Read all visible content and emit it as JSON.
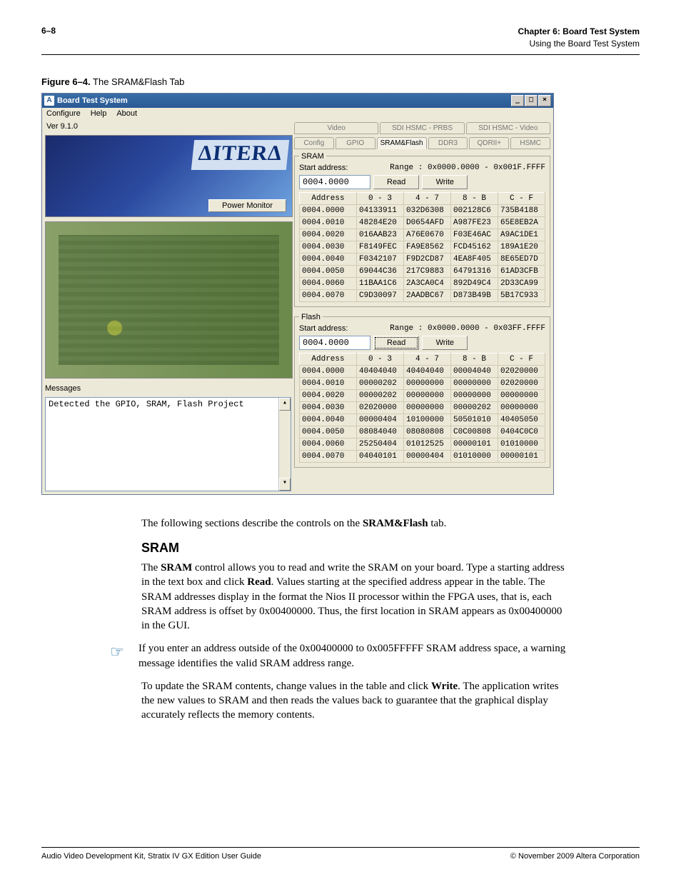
{
  "page": {
    "number": "6–8",
    "chapter": "Chapter 6:  Board Test System",
    "section": "Using the Board Test System"
  },
  "figcap": {
    "label": "Figure 6–4.",
    "title": "The SRAM&Flash Tab"
  },
  "win": {
    "title": "Board Test System",
    "menu": [
      "Configure",
      "Help",
      "About"
    ],
    "version": "Ver 9.1.0",
    "altera_logo": "ΔITERΔ",
    "power_monitor": "Power Monitor",
    "messages_label": "Messages",
    "messages_text": "Detected the GPIO, SRAM, Flash Project",
    "tabs_top": [
      "Video",
      "SDI HSMC - PRBS",
      "SDI HSMC - Video"
    ],
    "tabs_bot": [
      "Config",
      "GPIO",
      "SRAM&Flash",
      "DDR3",
      "QDRII+",
      "HSMC"
    ],
    "active_tab": "SRAM&Flash",
    "labels": {
      "start_addr": "Start address:",
      "read": "Read",
      "write": "Write",
      "headers": [
        "Address",
        "0 - 3",
        "4 - 7",
        "8 - B",
        "C - F"
      ]
    },
    "sram": {
      "legend": "SRAM",
      "range": "Range : 0x0000.0000 - 0x001F.FFFF",
      "addr": "0004.0000",
      "rows": [
        [
          "0004.0000",
          "04133911",
          "032D6308",
          "002128C6",
          "735B4188"
        ],
        [
          "0004.0010",
          "48284E20",
          "D0654AFD",
          "A987FE23",
          "65E8EB2A"
        ],
        [
          "0004.0020",
          "016AAB23",
          "A76E0670",
          "F03E46AC",
          "A9AC1DE1"
        ],
        [
          "0004.0030",
          "F8149FEC",
          "FA9E8562",
          "FCD45162",
          "189A1E20"
        ],
        [
          "0004.0040",
          "F0342107",
          "F9D2CD87",
          "4EA8F405",
          "8E65ED7D"
        ],
        [
          "0004.0050",
          "69044C36",
          "217C9883",
          "64791316",
          "61AD3CFB"
        ],
        [
          "0004.0060",
          "11BAA1C6",
          "2A3CA0C4",
          "892D49C4",
          "2D33CA99"
        ],
        [
          "0004.0070",
          "C9D30097",
          "2AADBC67",
          "D873B49B",
          "5B17C933"
        ]
      ]
    },
    "flash": {
      "legend": "Flash",
      "range": "Range : 0x0000.0000 - 0x03FF.FFFF",
      "addr": "0004.0000",
      "rows": [
        [
          "0004.0000",
          "40404040",
          "40404040",
          "00004040",
          "02020000"
        ],
        [
          "0004.0010",
          "00000202",
          "00000000",
          "00000000",
          "02020000"
        ],
        [
          "0004.0020",
          "00000202",
          "00000000",
          "00000000",
          "00000000"
        ],
        [
          "0004.0030",
          "02020000",
          "00000000",
          "00000202",
          "00000000"
        ],
        [
          "0004.0040",
          "00000404",
          "10100000",
          "50501010",
          "40405050"
        ],
        [
          "0004.0050",
          "08084040",
          "08080808",
          "C0C00808",
          "0404C0C0"
        ],
        [
          "0004.0060",
          "25250404",
          "01012525",
          "00000101",
          "01010000"
        ],
        [
          "0004.0070",
          "04040101",
          "00000404",
          "01010000",
          "00000101"
        ]
      ]
    }
  },
  "body": {
    "intro": "The following sections describe the controls on the ",
    "intro_bold": "SRAM&Flash",
    "intro_tail": " tab.",
    "h2": "SRAM",
    "p1a": "The ",
    "p1b": "SRAM",
    "p1c": " control allows you to read and write the SRAM on your board. Type a starting address in the text box and click ",
    "p1d": "Read",
    "p1e": ". Values starting at the specified address appear in the table. The SRAM addresses display in the format the Nios II processor within the FPGA uses, that is, each SRAM address is offset by 0x00400000. Thus, the first location in SRAM appears as 0x00400000 in the GUI.",
    "note": "If you enter an address outside of the 0x00400000 to 0x005FFFFF SRAM address space, a warning message identifies the valid SRAM address range.",
    "p2a": "To update the SRAM contents, change values in the table and click ",
    "p2b": "Write",
    "p2c": ". The application writes the new values to SRAM and then reads the values back to guarantee that the graphical display accurately reflects the memory contents."
  },
  "footer": {
    "left": "Audio Video Development Kit, Stratix IV GX Edition User Guide",
    "right": "© November 2009    Altera Corporation"
  }
}
